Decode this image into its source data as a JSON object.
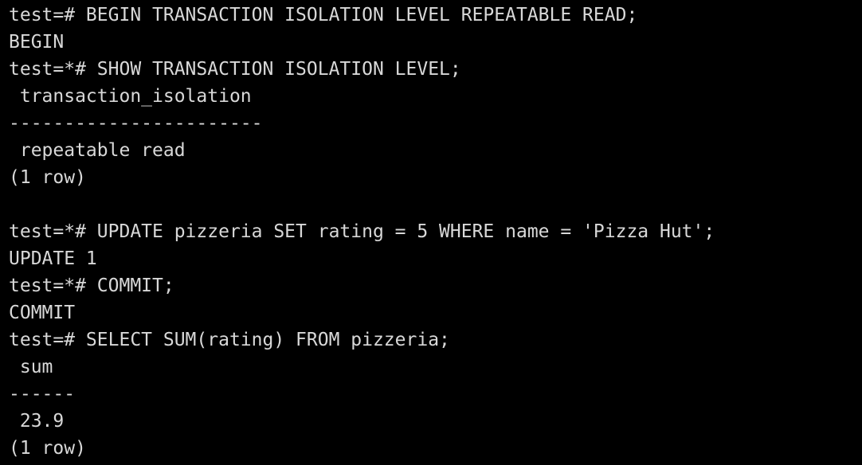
{
  "terminal": {
    "background": "#000000",
    "foreground": "#d8d8d8",
    "lines": [
      "test=# BEGIN TRANSACTION ISOLATION LEVEL REPEATABLE READ;",
      "BEGIN",
      "test=*# SHOW TRANSACTION ISOLATION LEVEL;",
      " transaction_isolation",
      "-----------------------",
      " repeatable read",
      "(1 row)",
      "",
      "test=*# UPDATE pizzeria SET rating = 5 WHERE name = 'Pizza Hut';",
      "UPDATE 1",
      "test=*# COMMIT;",
      "COMMIT",
      "test=# SELECT SUM(rating) FROM pizzeria;",
      " sum",
      "------",
      " 23.9",
      "(1 row)"
    ]
  }
}
